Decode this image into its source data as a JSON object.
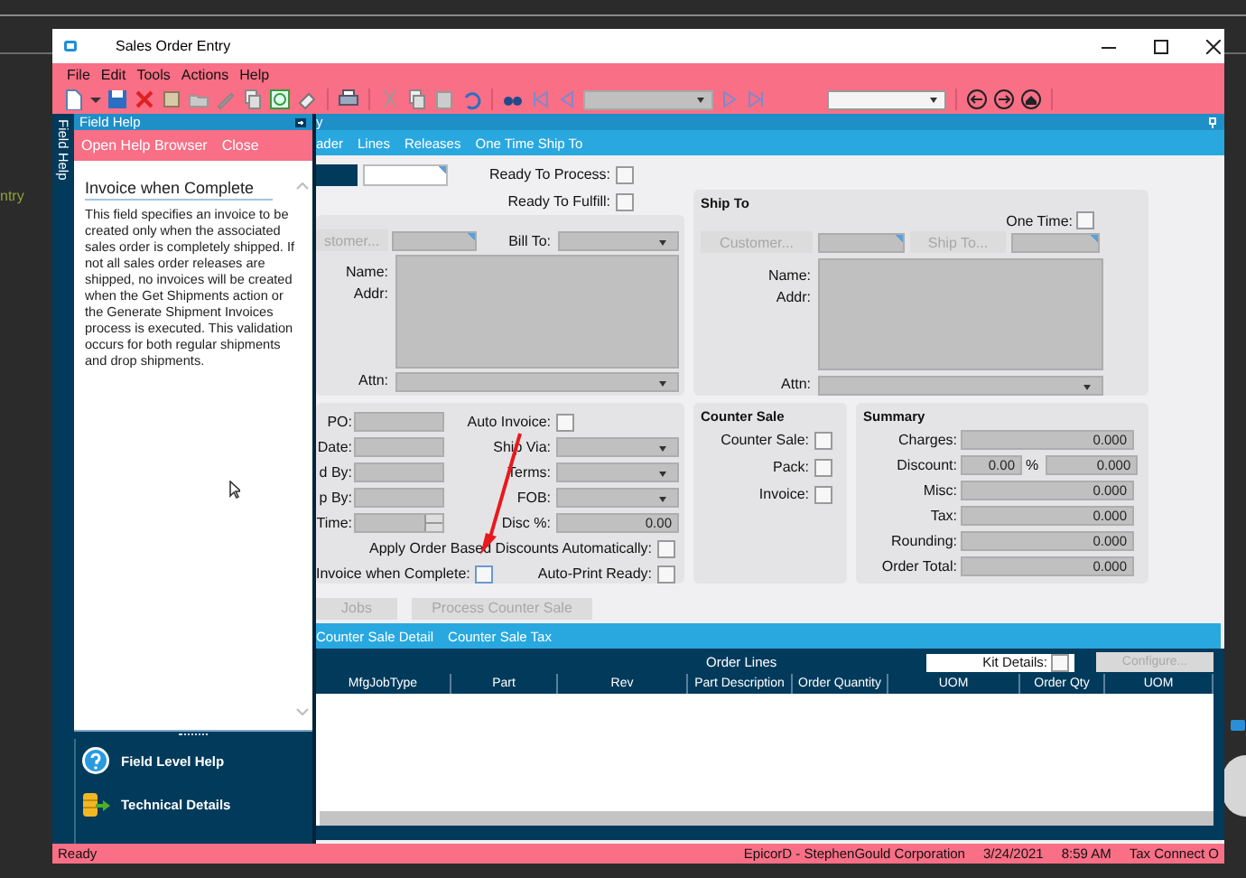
{
  "desktop": {
    "side_text": "ntry"
  },
  "window": {
    "title": "Sales Order Entry"
  },
  "menu": [
    {
      "label": "File"
    },
    {
      "label": "Edit"
    },
    {
      "label": "Tools"
    },
    {
      "label": "Actions"
    },
    {
      "label": "Help"
    }
  ],
  "field_help": {
    "tab_label": "Field Help",
    "title": "Field Help",
    "actions": [
      {
        "label": "Open Help Browser"
      },
      {
        "label": "Close"
      }
    ],
    "topic": "Invoice when Complete",
    "body": "This field specifies an invoice to be created only when the associated sales order is completely shipped. If not all sales order releases are shipped, no invoices will be created when the Get Shipments action or the Generate Shipment Invoices process is executed. This validation occurs for both regular shipments and drop shipments.",
    "links": [
      {
        "kind": "help",
        "label": "Field Level Help"
      },
      {
        "kind": "details",
        "label": "Technical Details"
      }
    ]
  },
  "form_title": "y",
  "tabs": [
    {
      "label": "ader"
    },
    {
      "label": "Lines"
    },
    {
      "label": "Releases"
    },
    {
      "label": "One Time Ship To"
    }
  ],
  "ready": [
    {
      "label": "Ready To Process:",
      "checked": false
    },
    {
      "label": "Ready To Fulfill:",
      "checked": false
    }
  ],
  "bill_to": {
    "customer_button": "stomer...",
    "bill_to_label": "Bill To:",
    "name_label": "Name:",
    "addr_label": "Addr:",
    "attn_label": "Attn:"
  },
  "ship_to": {
    "title": "Ship To",
    "one_time": {
      "label": "One Time:",
      "checked": false
    },
    "customer_button": "Customer...",
    "ship_to_button": "Ship To...",
    "name_label": "Name:",
    "addr_label": "Addr:",
    "attn_label": "Attn:"
  },
  "order_left": [
    {
      "label": "PO:",
      "kind": "text"
    },
    {
      "label": "Date:",
      "kind": "text"
    },
    {
      "label": "d By:",
      "kind": "text"
    },
    {
      "label": "p By:",
      "kind": "text"
    },
    {
      "label": "Time:",
      "kind": "spin"
    }
  ],
  "order_right": [
    {
      "label": "Auto Invoice:",
      "kind": "check",
      "checked": false
    },
    {
      "label": "Ship Via:",
      "kind": "combo"
    },
    {
      "label": "Terms:",
      "kind": "combo"
    },
    {
      "label": "FOB:",
      "kind": "combo"
    },
    {
      "label": "Disc %:",
      "kind": "number",
      "value": "0.00"
    }
  ],
  "apply_discounts": {
    "label": "Apply Order Based Discounts Automatically:",
    "checked": false
  },
  "invoice_when_complete": {
    "label": "Invoice when Complete:",
    "checked": false
  },
  "auto_print": {
    "label": "Auto-Print Ready:",
    "checked": false
  },
  "counter_sale": {
    "title": "Counter Sale",
    "items": [
      {
        "label": "Counter Sale:",
        "checked": false
      },
      {
        "label": "Pack:",
        "checked": false
      },
      {
        "label": "Invoice:",
        "checked": false
      }
    ]
  },
  "summary": {
    "title": "Summary",
    "rows": [
      {
        "label": "Charges:",
        "value": "0.000"
      },
      {
        "label": "Discount:",
        "percent": "0.00",
        "percent_sign": "%",
        "value": "0.000"
      },
      {
        "label": "Misc:",
        "value": "0.000"
      },
      {
        "label": "Tax:",
        "value": "0.000"
      },
      {
        "label": "Rounding:",
        "value": "0.000"
      },
      {
        "label": "Order Total:",
        "value": "0.000"
      }
    ]
  },
  "actions": [
    {
      "label": "Jobs",
      "disabled": true
    },
    {
      "label": "Process Counter Sale",
      "disabled": true
    }
  ],
  "lower_tabs": [
    {
      "label": "Counter Sale Detail"
    },
    {
      "label": "Counter Sale Tax"
    }
  ],
  "order_lines": {
    "title": "Order Lines",
    "kit_details": {
      "label": "Kit Details:",
      "checked": false
    },
    "configure": {
      "label": "Configure...",
      "disabled": true
    },
    "columns": [
      "MfgJobType",
      "Part",
      "Rev",
      "Part Description",
      "Order Quantity",
      "UOM",
      "Order Qty",
      "UOM"
    ]
  },
  "status_bar": {
    "left": "Ready",
    "items": [
      "EpicorD - StephenGould Corporation",
      "3/24/2021",
      "8:59 AM",
      "Tax Connect O"
    ]
  }
}
